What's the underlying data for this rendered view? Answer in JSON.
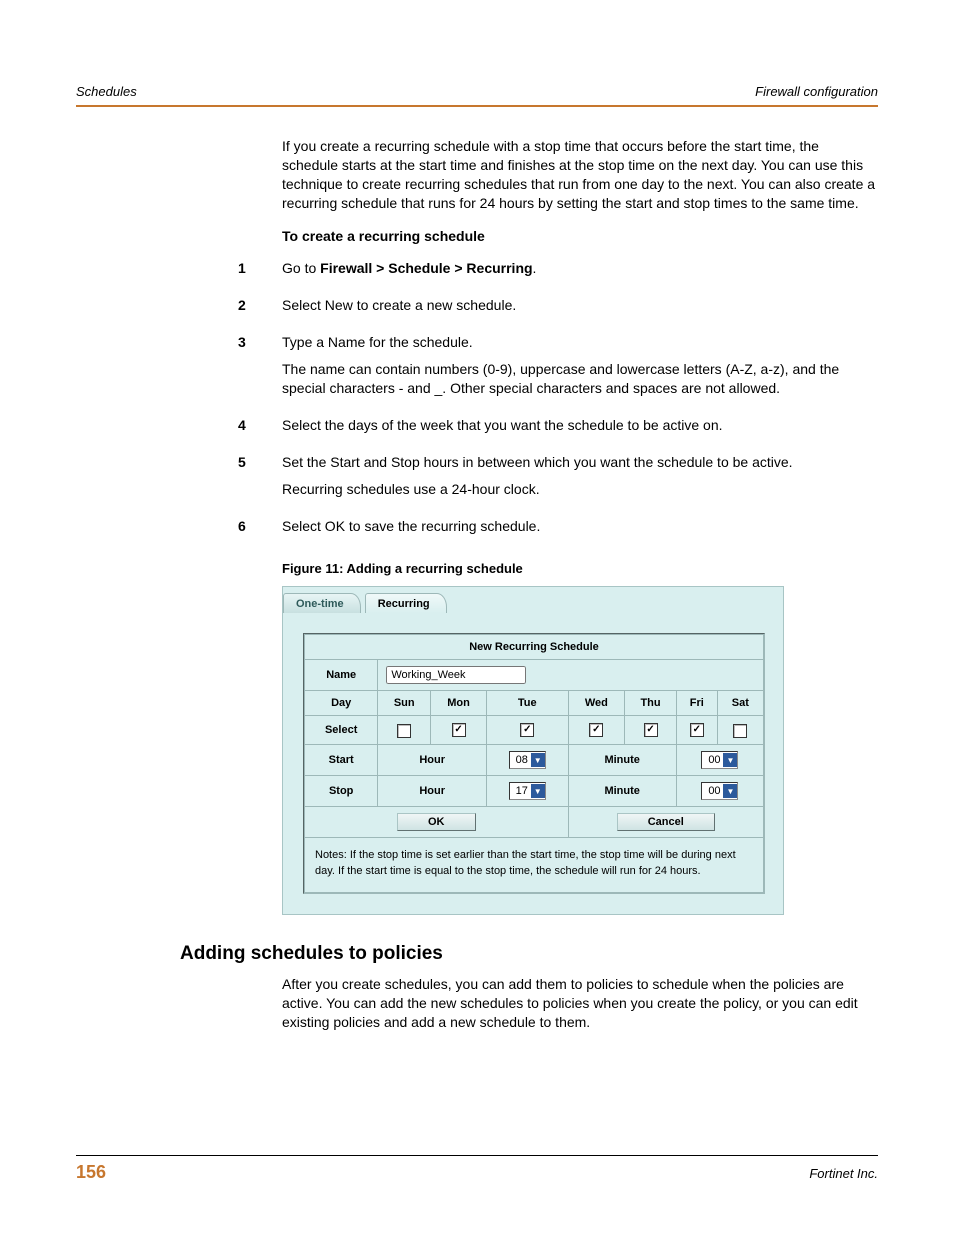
{
  "header": {
    "left": "Schedules",
    "right": "Firewall configuration"
  },
  "intro": "If you create a recurring schedule with a stop time that occurs before the start time, the schedule starts at the start time and finishes at the stop time on the next day. You can use this technique to create recurring schedules that run from one day to the next. You can also create a recurring schedule that runs for 24 hours by setting the start and stop times to the same time.",
  "proc_heading": "To create a recurring schedule",
  "steps": {
    "s1_pre": "Go to ",
    "s1_bold": "Firewall > Schedule > Recurring",
    "s1_post": ".",
    "s2": "Select New to create a new schedule.",
    "s3_a": "Type a Name for the schedule.",
    "s3_b": "The name can contain numbers (0-9), uppercase and lowercase letters (A-Z, a-z), and the special characters - and _. Other special characters and spaces are not allowed.",
    "s4": "Select the days of the week that you want the schedule to be active on.",
    "s5_a": "Set the Start and Stop hours in between which you want the schedule to be active.",
    "s5_b": "Recurring schedules use a 24-hour clock.",
    "s6": "Select OK to save the recurring schedule."
  },
  "figure": {
    "caption": "Figure 11: Adding a recurring schedule",
    "tabs": {
      "inactive": "One-time",
      "active": "Recurring"
    },
    "panel_title": "New Recurring Schedule",
    "labels": {
      "name": "Name",
      "day": "Day",
      "select": "Select",
      "start": "Start",
      "stop": "Stop",
      "hour": "Hour",
      "minute": "Minute",
      "ok": "OK",
      "cancel": "Cancel"
    },
    "name_value": "Working_Week",
    "days": [
      "Sun",
      "Mon",
      "Tue",
      "Wed",
      "Thu",
      "Fri",
      "Sat"
    ],
    "checks": [
      "",
      "✓",
      "✓",
      "✓",
      "✓",
      "✓",
      ""
    ],
    "start_hour": "08",
    "start_min": "00",
    "stop_hour": "17",
    "stop_min": "00",
    "notes": "Notes: If the stop time is set earlier than the start time, the stop time will be during next day. If the start time is equal to the stop time, the schedule will run for 24 hours."
  },
  "section2": {
    "heading": "Adding schedules to policies",
    "para": "After you create schedules, you can add them to policies to schedule when the policies are active. You can add the new schedules to policies when you create the policy, or you can edit existing policies and add a new schedule to them."
  },
  "footer": {
    "page": "156",
    "right": "Fortinet Inc."
  }
}
